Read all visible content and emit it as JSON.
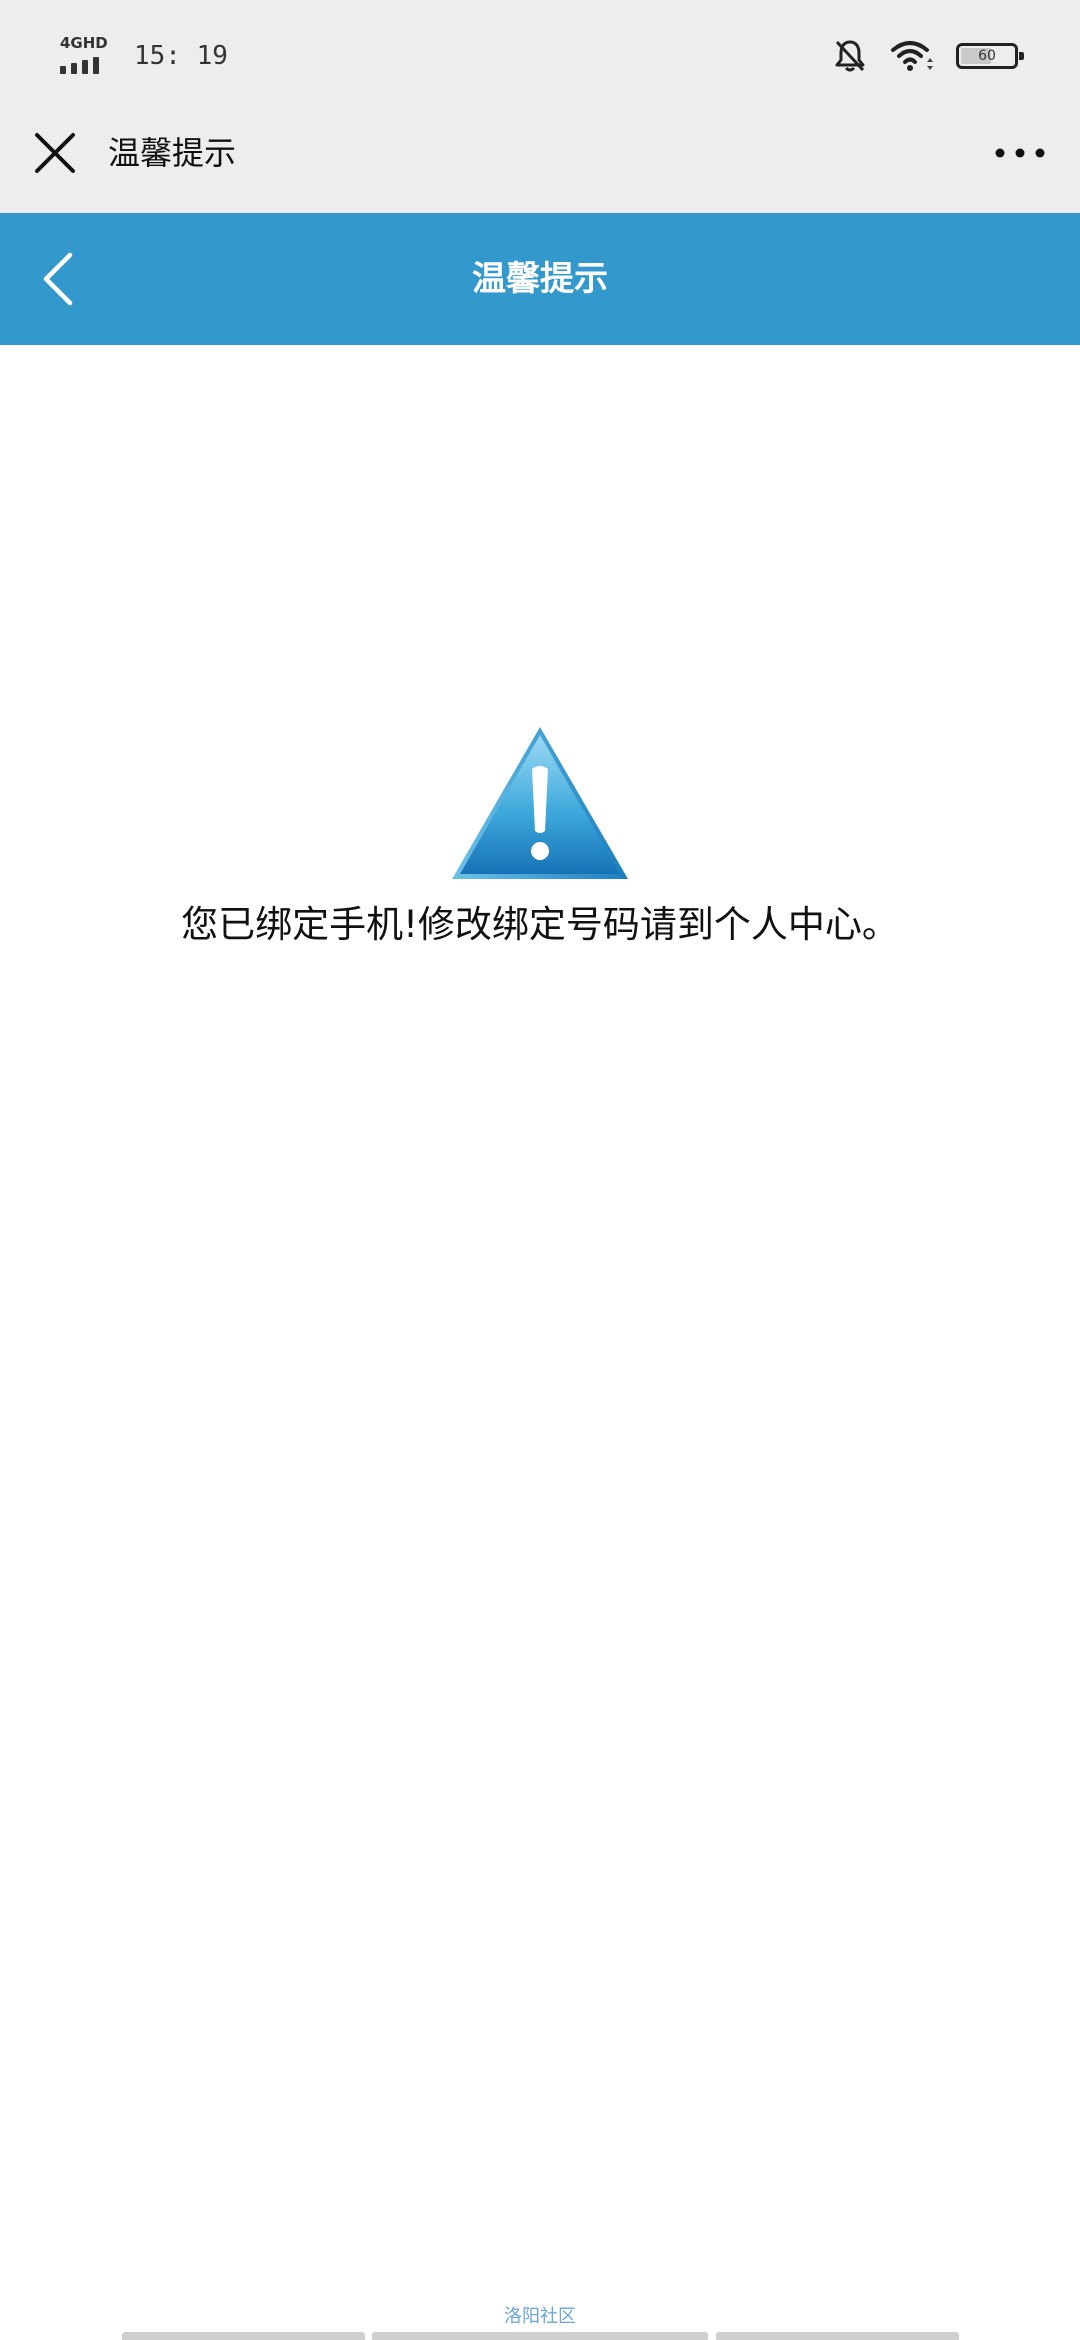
{
  "status_bar": {
    "network": "4GHD",
    "time": "15: 19",
    "battery": "60",
    "battery_level": 0.6
  },
  "title_bar": {
    "close_icon": "close-icon",
    "title": "温馨提示",
    "more_icon": "more-icon"
  },
  "header": {
    "back_icon": "chevron-left-icon",
    "title": "温馨提示"
  },
  "main": {
    "icon": "warning-triangle-icon",
    "message": "您已绑定手机!修改绑定号码请到个人中心。"
  },
  "footer": {
    "link": "洛阳社区"
  },
  "colors": {
    "header_bg": "#3399cc",
    "chrome_bg": "#ededed",
    "warning_light": "#8fd3ef",
    "warning_dark": "#1b7fc0"
  }
}
